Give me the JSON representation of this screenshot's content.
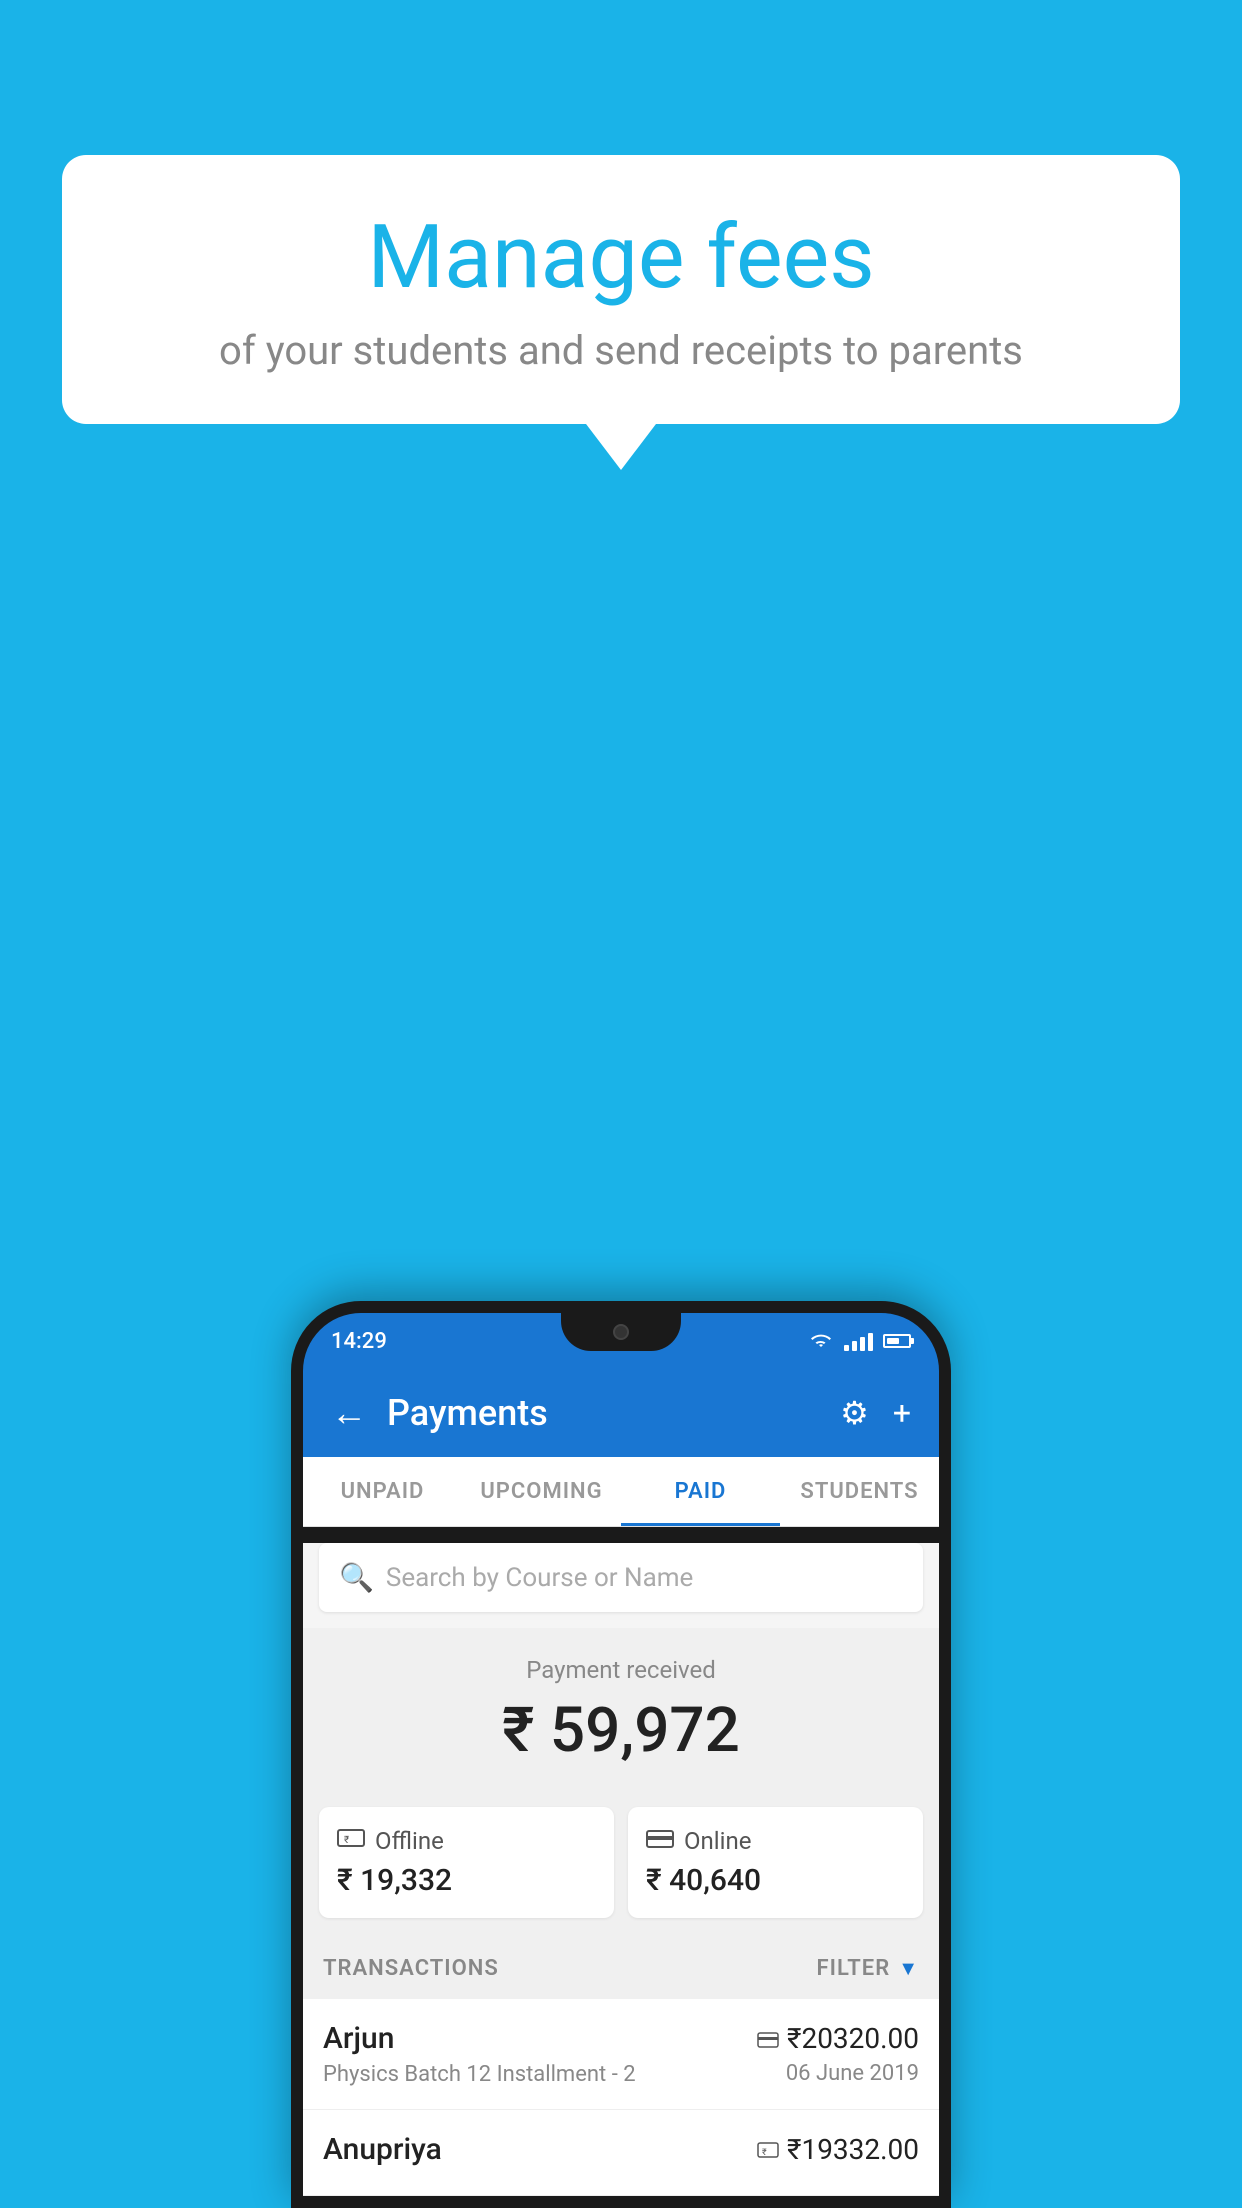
{
  "background_color": "#1ab3e8",
  "speech_bubble": {
    "title": "Manage fees",
    "subtitle": "of your students and send receipts to parents"
  },
  "status_bar": {
    "time": "14:29"
  },
  "app_bar": {
    "title": "Payments",
    "back_label": "←",
    "gear_label": "⚙",
    "plus_label": "+"
  },
  "tabs": [
    {
      "label": "UNPAID",
      "active": false
    },
    {
      "label": "UPCOMING",
      "active": false
    },
    {
      "label": "PAID",
      "active": true
    },
    {
      "label": "STUDENTS",
      "active": false
    }
  ],
  "search": {
    "placeholder": "Search by Course or Name"
  },
  "payment_section": {
    "label": "Payment received",
    "amount": "₹ 59,972",
    "offline": {
      "label": "Offline",
      "amount": "₹ 19,332"
    },
    "online": {
      "label": "Online",
      "amount": "₹ 40,640"
    }
  },
  "transactions": {
    "header": "TRANSACTIONS",
    "filter": "FILTER",
    "rows": [
      {
        "name": "Arjun",
        "course": "Physics Batch 12 Installment - 2",
        "amount": "₹20320.00",
        "date": "06 June 2019",
        "payment_type": "online"
      },
      {
        "name": "Anupriya",
        "course": "",
        "amount": "₹19332.00",
        "date": "",
        "payment_type": "offline"
      }
    ]
  }
}
